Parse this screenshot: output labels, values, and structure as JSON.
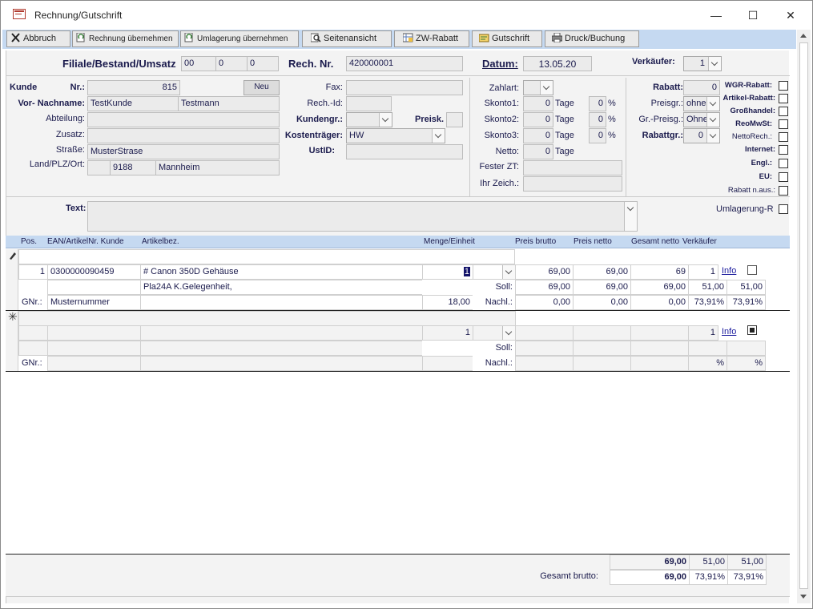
{
  "window": {
    "title": "Rechnung/Gutschrift",
    "minimize": "—",
    "maximize": "☐",
    "close": "✕"
  },
  "toolbar": {
    "abbruch": "Abbruch",
    "rechnung": "Rechnung übernehmen",
    "umlagerung": "Umlagerung übernehmen",
    "seitenansicht": "Seitenansicht",
    "zw_rabatt": "ZW-Rabatt",
    "gutschrift": "Gutschrift",
    "druck": "Druck/Buchung"
  },
  "header": {
    "filiale_label": "Filiale/Bestand/Umsatz",
    "filiale": "00",
    "bestand": "0",
    "umsatz": "0",
    "rechnr_label": "Rech. Nr.",
    "rechnr": "420000001",
    "datum_label": "Datum:",
    "datum": "13.05.20",
    "verkaeufer_label": "Verkäufer:",
    "verkaeufer": "1"
  },
  "kunde": {
    "kunde_label": "Kunde",
    "nr_label": "Nr.:",
    "nr": "815",
    "neu": "Neu",
    "name_label": "Vor- Nachname:",
    "vorname": "TestKunde",
    "nachname": "Testmann",
    "abteilung_label": "Abteilung:",
    "zusatz_label": "Zusatz:",
    "strasse_label": "Straße:",
    "strasse": "MusterStrase",
    "ort_label": "Land/PLZ/Ort:",
    "plz": "9188",
    "ort": "Mannheim"
  },
  "mid": {
    "fax_label": "Fax:",
    "rechid_label": "Rech.-Id:",
    "kundengr_label": "Kundengr.:",
    "preisk_label": "Preisk.",
    "kostentraeger_label": "Kostenträger:",
    "kostentraeger": "HW",
    "ustid_label": "UstID:"
  },
  "zahlung": {
    "zahlart_label": "Zahlart:",
    "skonto1_label": "Skonto1:",
    "skonto1": "0",
    "skonto1_pct": "0",
    "skonto2_label": "Skonto2:",
    "skonto2": "0",
    "skonto2_pct": "0",
    "skonto3_label": "Skonto3:",
    "skonto3": "0",
    "skonto3_pct": "0",
    "tage": "Tage",
    "pct": "%",
    "netto_label": "Netto:",
    "netto": "0",
    "fester_zt_label": "Fester ZT:",
    "ihr_zeich_label": "Ihr Zeich.:"
  },
  "rabatt": {
    "rabatt_label": "Rabatt:",
    "rabatt": "0",
    "preisgr_label": "Preisgr.:",
    "preisgr": "ohne",
    "grpreisg_label": "Gr.-Preisg.:",
    "grpreisg": "Ohne",
    "rabattgr_label": "Rabattgr.:",
    "rabattgr": "0"
  },
  "flags": [
    "WGR-Rabatt:",
    "Artikel-Rabatt:",
    "Großhandel:",
    "ReoMwSt:",
    "NettoRech.:",
    "Internet:",
    "Engl.:",
    "EU:",
    "Rabatt n.aus.:"
  ],
  "text_label": "Text:",
  "umlagerung_label": "Umlagerung-R",
  "grid": {
    "headers": {
      "pos": "Pos.",
      "ean": "EAN/ArtikelNr. Kunde",
      "bez": "Artikelbez.",
      "menge": "Menge/Einheit",
      "preis_brutto": "Preis brutto",
      "preis_netto": "Preis netto",
      "gesamt_netto": "Gesamt netto",
      "verkaeufer": "Verkäufer"
    },
    "row1": {
      "pos": "1",
      "ean": "0300000090459",
      "bez": "# Canon 350D Gehäuse",
      "menge": "1",
      "preis_brutto": "69,00",
      "preis_netto": "69,00",
      "gesamt": "69",
      "verkaeufer": "1",
      "info": "Info",
      "bez2": "Pla24A K.Gelegenheit,",
      "soll_label": "Soll:",
      "soll_brutto": "69,00",
      "soll_netto": "69,00",
      "soll_gesamt": "69,00",
      "soll_v1": "51,00",
      "soll_v2": "51,00",
      "gnr_label": "GNr.:",
      "gnr": "Musternummer",
      "gnr_menge": "18,00",
      "nachl_label": "Nachl.:",
      "nachl_brutto": "0,00",
      "nachl_netto": "0,00",
      "nachl_gesamt": "0,00",
      "nachl_p1": "73,91%",
      "nachl_p2": "73,91%"
    },
    "new_row": {
      "menge": "1",
      "verkaeufer": "1",
      "info": "Info",
      "soll_label": "Soll:",
      "gnr_label": "GNr.:",
      "nachl_label": "Nachl.:",
      "p1": "%",
      "p2": "%"
    }
  },
  "footer": {
    "sum1": "69,00",
    "sum1_b": "51,00",
    "sum1_c": "51,00",
    "gesamt_label": "Gesamt brutto:",
    "sum2": "69,00",
    "sum2_b": "73,91%",
    "sum2_c": "73,91%"
  }
}
